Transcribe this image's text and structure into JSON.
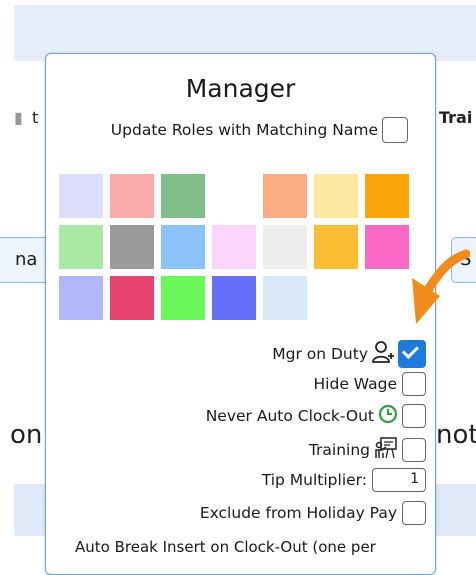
{
  "background": {
    "left_text_top": "t",
    "left_text_mid": "na",
    "left_text_low": "on",
    "right_text_top": "Trai",
    "right_text_mid": "S",
    "right_text_low": "not"
  },
  "popup": {
    "title": "Manager",
    "update_roles_label": "Update Roles with Matching Name",
    "update_roles_checked": false,
    "swatches": [
      [
        "#dcdcfb",
        "#fbaaaa",
        "#80be88",
        "",
        "#fbad82",
        "#fde7a0",
        "#fca60a"
      ],
      [
        "#a9e8a5",
        "#9a9a9a",
        "#8dc3fb",
        "#fbd6fb",
        "#eeeeee",
        "#fbbe34",
        "#fa69c5"
      ],
      [
        "#b2b7fb",
        "#e5426e",
        "#6af85a",
        "#656ff9",
        "#dae9f7",
        "",
        ""
      ]
    ],
    "mgr_on_duty_label": "Mgr on Duty",
    "mgr_on_duty_checked": true,
    "hide_wage_label": "Hide Wage",
    "never_auto_clockout_label": "Never Auto Clock-Out",
    "training_label": "Training",
    "tip_multiplier_label": "Tip Multiplier:",
    "tip_multiplier_value": "1",
    "exclude_holiday_label": "Exclude from Holiday Pay",
    "auto_break_label": "Auto Break Insert on Clock-Out (one per"
  },
  "colors": {
    "accent": "#1d7bde",
    "arrow": "#f28a1c",
    "clock": "#2e9b47",
    "border": "#6ea1d6"
  },
  "icons": {
    "mgr": "person-add-icon",
    "clock": "clock-icon",
    "training": "training-board-icon",
    "arrow": "curved-arrow-icon"
  }
}
